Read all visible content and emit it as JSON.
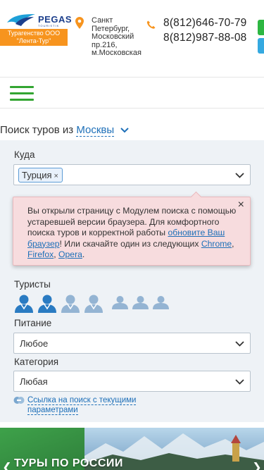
{
  "header": {
    "logo_text": "PEGAS",
    "logo_subtext": "TOURISTIK",
    "agency": "Турагенство ООО \"Лента-Тур\"",
    "address_lines": [
      "Санкт",
      "Петербург,",
      "Московский",
      "пр.216,",
      "м.Московская"
    ],
    "phones": [
      "8(812)646-70-79",
      "8(812)987-88-08"
    ]
  },
  "search": {
    "prefix": "Поиск туров из",
    "city": "Москвы"
  },
  "form": {
    "destination_label": "Куда",
    "destination_tag": "Турция",
    "tourists_label": "Туристы",
    "meal_label": "Питание",
    "meal_value": "Любое",
    "category_label": "Категория",
    "category_value": "Любая",
    "share_link": "Ссылка на поиск с текущими параметрами"
  },
  "alert": {
    "text_before": "Вы открыли страницу с Модулем поиска с помощью устаревшей версии браузера. Для комфортного поиска туров и корректной работы ",
    "update_link": "обновите Ваш браузер",
    "text_after": "! Или скачайте один из следующих ",
    "browsers": [
      "Chrome",
      "Firefox",
      "Opera"
    ],
    "sep1": ", ",
    "sep2": ", ",
    "end": ".",
    "close": "×"
  },
  "banner": {
    "title": "ТУРЫ ПО РОССИИ"
  },
  "colors": {
    "accent_green": "#33a532",
    "link_blue": "#1d6fb8",
    "brand_orange": "#f7941e",
    "alert_bg": "#f7dcde"
  }
}
